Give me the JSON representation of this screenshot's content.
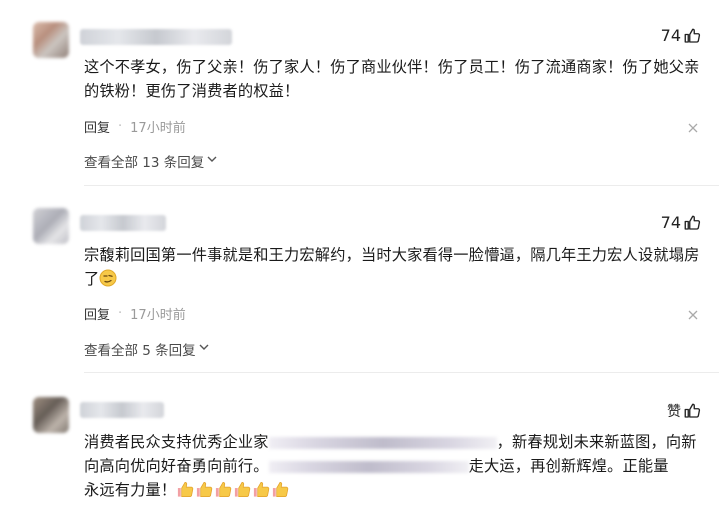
{
  "comments": [
    {
      "likes": "74",
      "text": "这个不孝女，伤了父亲！伤了家人！伤了商业伙伴！伤了员工！伤了流通商家！伤了她父亲的铁粉！更伤了消费者的权益！",
      "reply_label": "回复",
      "dot": "·",
      "time": "17小时前",
      "view_all": "查看全部 13 条回复"
    },
    {
      "likes": "74",
      "text": "宗馥莉回国第一件事就是和王力宏解约，当时大家看得一脸懵逼，隔几年王力宏人设就塌房了",
      "emoji": "smirk-emoji",
      "reply_label": "回复",
      "dot": "·",
      "time": "17小时前",
      "view_all": "查看全部 5 条回复"
    },
    {
      "likes": "赞",
      "line1_a": "消费者民众支持优秀企业家",
      "line1_b": "，新春规划未来新蓝图，向新",
      "line2_a": "向高向优向好奋勇向前行。",
      "line2_b": "走大运，再创新辉煌。正能量",
      "line3": "永远有力量！",
      "thumbs_count": 6
    }
  ],
  "icons": {
    "like": "thumbs-up-icon",
    "close": "close-icon",
    "chevron": "chevron-down-icon"
  }
}
